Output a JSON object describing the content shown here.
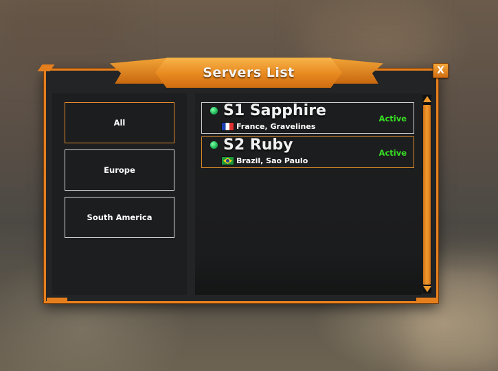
{
  "window": {
    "title": "Servers List",
    "close_label": "X"
  },
  "regions": [
    {
      "label": "All",
      "active": true
    },
    {
      "label": "Europe",
      "active": false
    },
    {
      "label": "South America",
      "active": false
    }
  ],
  "servers": [
    {
      "name": "S1 Sapphire",
      "location": "France, Gravelines",
      "flag": "france-flag-icon",
      "status": "Active",
      "status_color": "#37e024",
      "online_indicator": "green-dot"
    },
    {
      "name": "S2 Ruby",
      "location": "Brazil, Sao Paulo",
      "flag": "brazil-flag-icon",
      "status": "Active",
      "status_color": "#37e024",
      "online_indicator": "green-dot"
    }
  ],
  "theme": {
    "accent": "#e57f1e",
    "panel_bg": "#232425"
  }
}
